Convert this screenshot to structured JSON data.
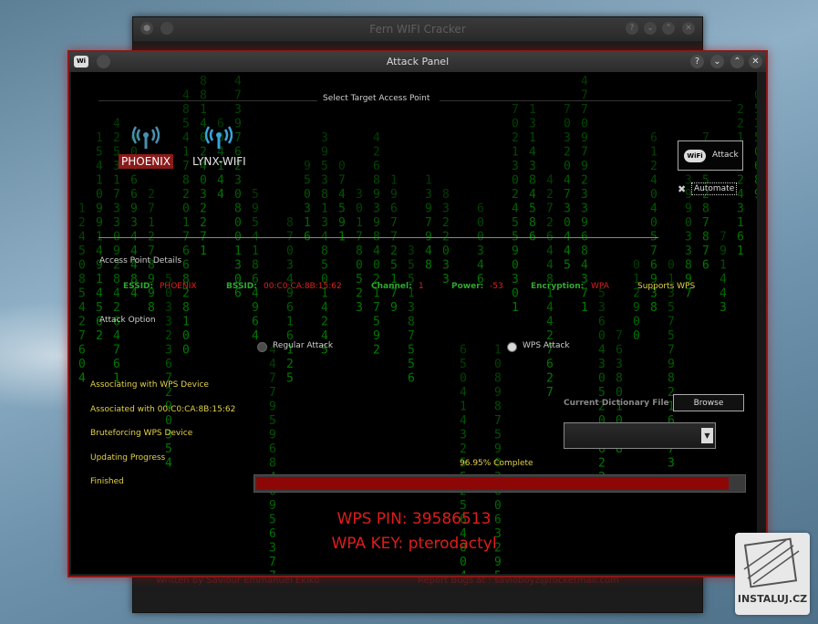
{
  "back_window": {
    "title": "Fern WIFI Cracker",
    "footer_left": "Written by Saviour Emmanuel Ekiko",
    "footer_right": "Report Bugs at : savioboyz@rocketmail.com"
  },
  "dialog": {
    "title": "Attack Panel",
    "controls": {
      "help": "?",
      "minimize": "⌄",
      "maximize": "⌃",
      "close": "✕"
    }
  },
  "target": {
    "section_title": "Select Target Access Point",
    "access_points": [
      {
        "ssid": "PHOENIX",
        "selected": true,
        "icon": "wifi-signal-icon"
      },
      {
        "ssid": "LYNX-WIFI",
        "selected": false,
        "icon": "wifi-signal-icon"
      }
    ]
  },
  "attack_button": {
    "label": "Attack"
  },
  "automate": {
    "label": "Automate",
    "checked": false
  },
  "details": {
    "section_title": "Access Point Details",
    "essid_label": "ESSID:",
    "essid": "PHOENIX",
    "bssid_label": "BSSID:",
    "bssid": "00:C0:CA:8B:15:62",
    "channel_label": "Channel:",
    "channel": "1",
    "power_label": "Power:",
    "power": "-53",
    "encryption_label": "Encryption:",
    "encryption": "WPA",
    "wps_support": "Supports WPS"
  },
  "attack_option": {
    "section_title": "Attack Option",
    "regular": {
      "label": "Regular Attack",
      "selected": false
    },
    "wps": {
      "label": "WPS  Attack",
      "selected": true
    }
  },
  "status_steps": [
    "Associating with WPS Device",
    "Associated with 00:C0:CA:8B:15:62",
    "Bruteforcing WPS Device",
    "Updating Progress",
    "Finished"
  ],
  "dictionary": {
    "label": "Current Dictionary File",
    "browse_label": "Browse",
    "selected": ""
  },
  "progress": {
    "text": "96.95% Complete",
    "value": 0.9695
  },
  "result": {
    "wps_pin": "WPS PIN: 39586513",
    "wpa_key": "WPA KEY: pterodactyl"
  },
  "watermark": {
    "text": "INSTALUJ.CZ"
  },
  "colors": {
    "accent_red": "#8b1a1a",
    "label_green": "#2fa82f",
    "value_red": "#e02020",
    "status_yellow": "#e2d24a"
  }
}
